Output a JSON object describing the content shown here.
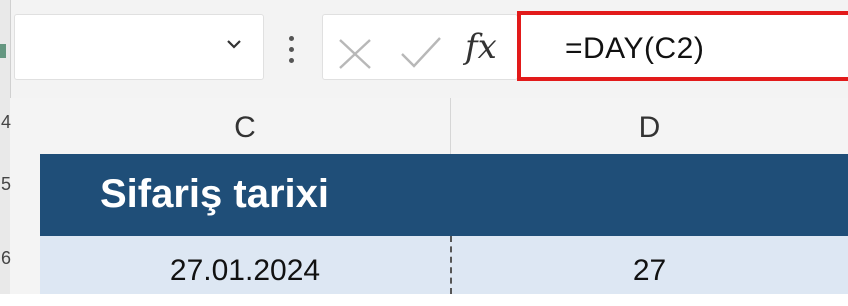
{
  "formula_bar": {
    "fx_label": "fx",
    "formula": "=DAY(C2)"
  },
  "column_headers": [
    "C",
    "D"
  ],
  "row_headers": [
    "4",
    "5",
    "6"
  ],
  "sheet": {
    "header_cell": "Sifariş tarixi",
    "row2": {
      "c": "27.01.2024",
      "d": "27"
    }
  },
  "colors": {
    "header_fill": "#1f4e78",
    "data_fill": "#dde7f3",
    "formula_highlight": "#e21a1a"
  }
}
